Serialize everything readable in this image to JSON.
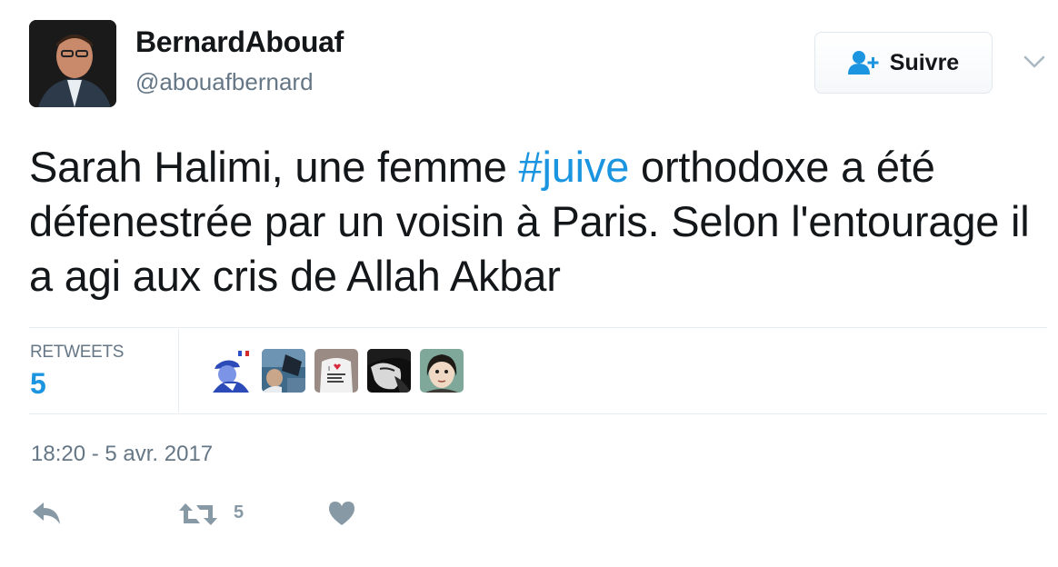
{
  "author": {
    "display_name": "BernardAbouaf",
    "handle": "@abouafbernard",
    "avatar_icon": "user-avatar-photo"
  },
  "follow_button": {
    "label": "Suivre",
    "icon": "follow-user-plus-icon",
    "accent_color": "#1b95e0"
  },
  "menu": {
    "icon": "chevron-down-icon"
  },
  "tweet": {
    "text_before": "Sarah Halimi, une femme ",
    "hashtag": "#juive",
    "text_after": " orthodoxe a été défenestrée par un voisin à Paris. Selon l'entourage il a agi aux cris de Allah Akbar",
    "hashtag_color": "#1b95e0"
  },
  "stats": {
    "retweets_label": "RETWEETS",
    "retweets_value": "5",
    "retweeter_avatars": [
      "retweeter-avatar-1",
      "retweeter-avatar-2",
      "retweeter-avatar-3",
      "retweeter-avatar-4",
      "retweeter-avatar-5"
    ]
  },
  "timestamp": "18:20 - 5 avr. 2017",
  "actions": {
    "reply_icon": "reply-icon",
    "retweet_icon": "retweet-icon",
    "retweet_count": "5",
    "like_icon": "heart-icon"
  }
}
